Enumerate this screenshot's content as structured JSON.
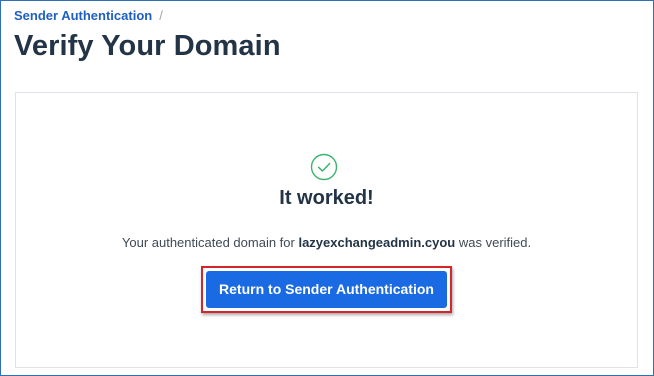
{
  "breadcrumb": {
    "link_label": "Sender Authentication",
    "separator": "/"
  },
  "page": {
    "title": "Verify Your Domain"
  },
  "result": {
    "icon": "check-circle-icon",
    "icon_color": "#3cb371",
    "headline": "It worked!",
    "message_prefix": "Your authenticated domain for ",
    "domain": "lazyexchangeadmin.cyou",
    "message_suffix": " was verified."
  },
  "actions": {
    "return_label": "Return to Sender Authentication",
    "button_color": "#1a6ae4",
    "highlight_color": "#d5242c"
  }
}
